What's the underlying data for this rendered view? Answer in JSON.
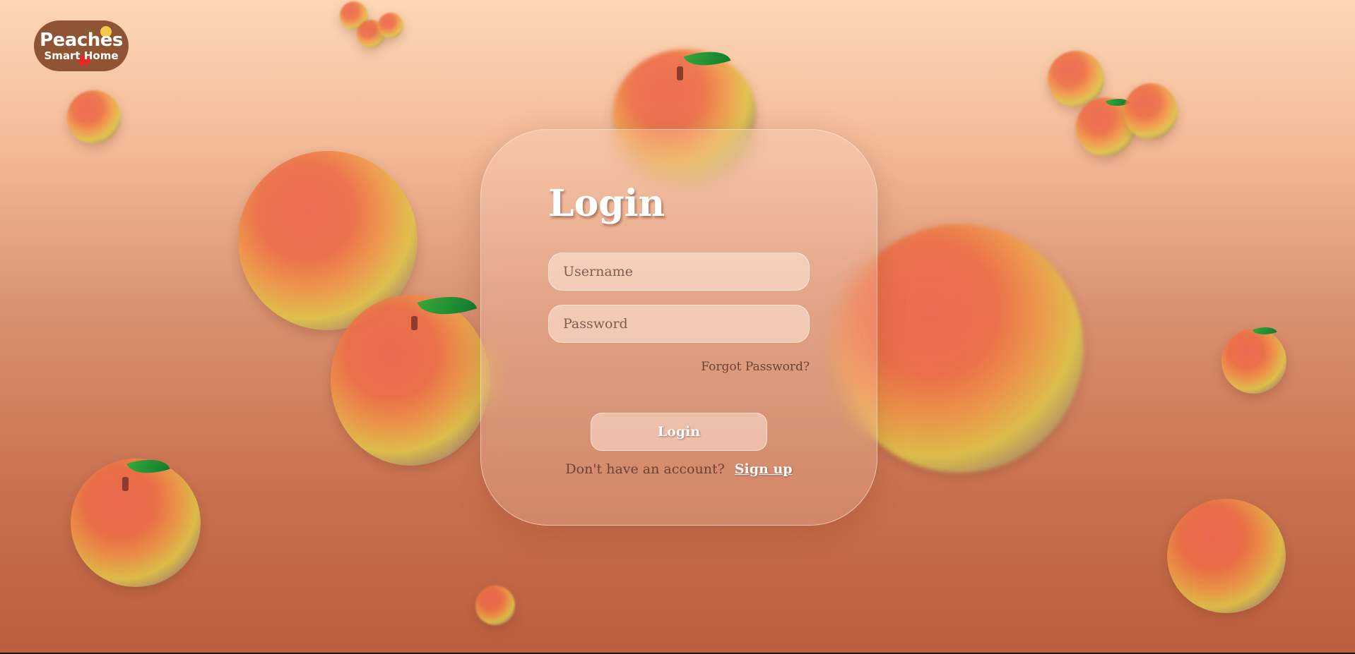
{
  "logo": {
    "title": "Peaches",
    "subtitle": "Smart Home"
  },
  "login": {
    "title": "Login",
    "username_placeholder": "Username",
    "password_placeholder": "Password",
    "forgot_label": "Forgot Password?",
    "submit_label": "Login",
    "signup_prompt": "Don't have an account?",
    "signup_label": "Sign up"
  },
  "colors": {
    "background_top": "#fed7b5",
    "background_bottom": "#bc5e3f",
    "logo_bg": "#8f5433"
  }
}
